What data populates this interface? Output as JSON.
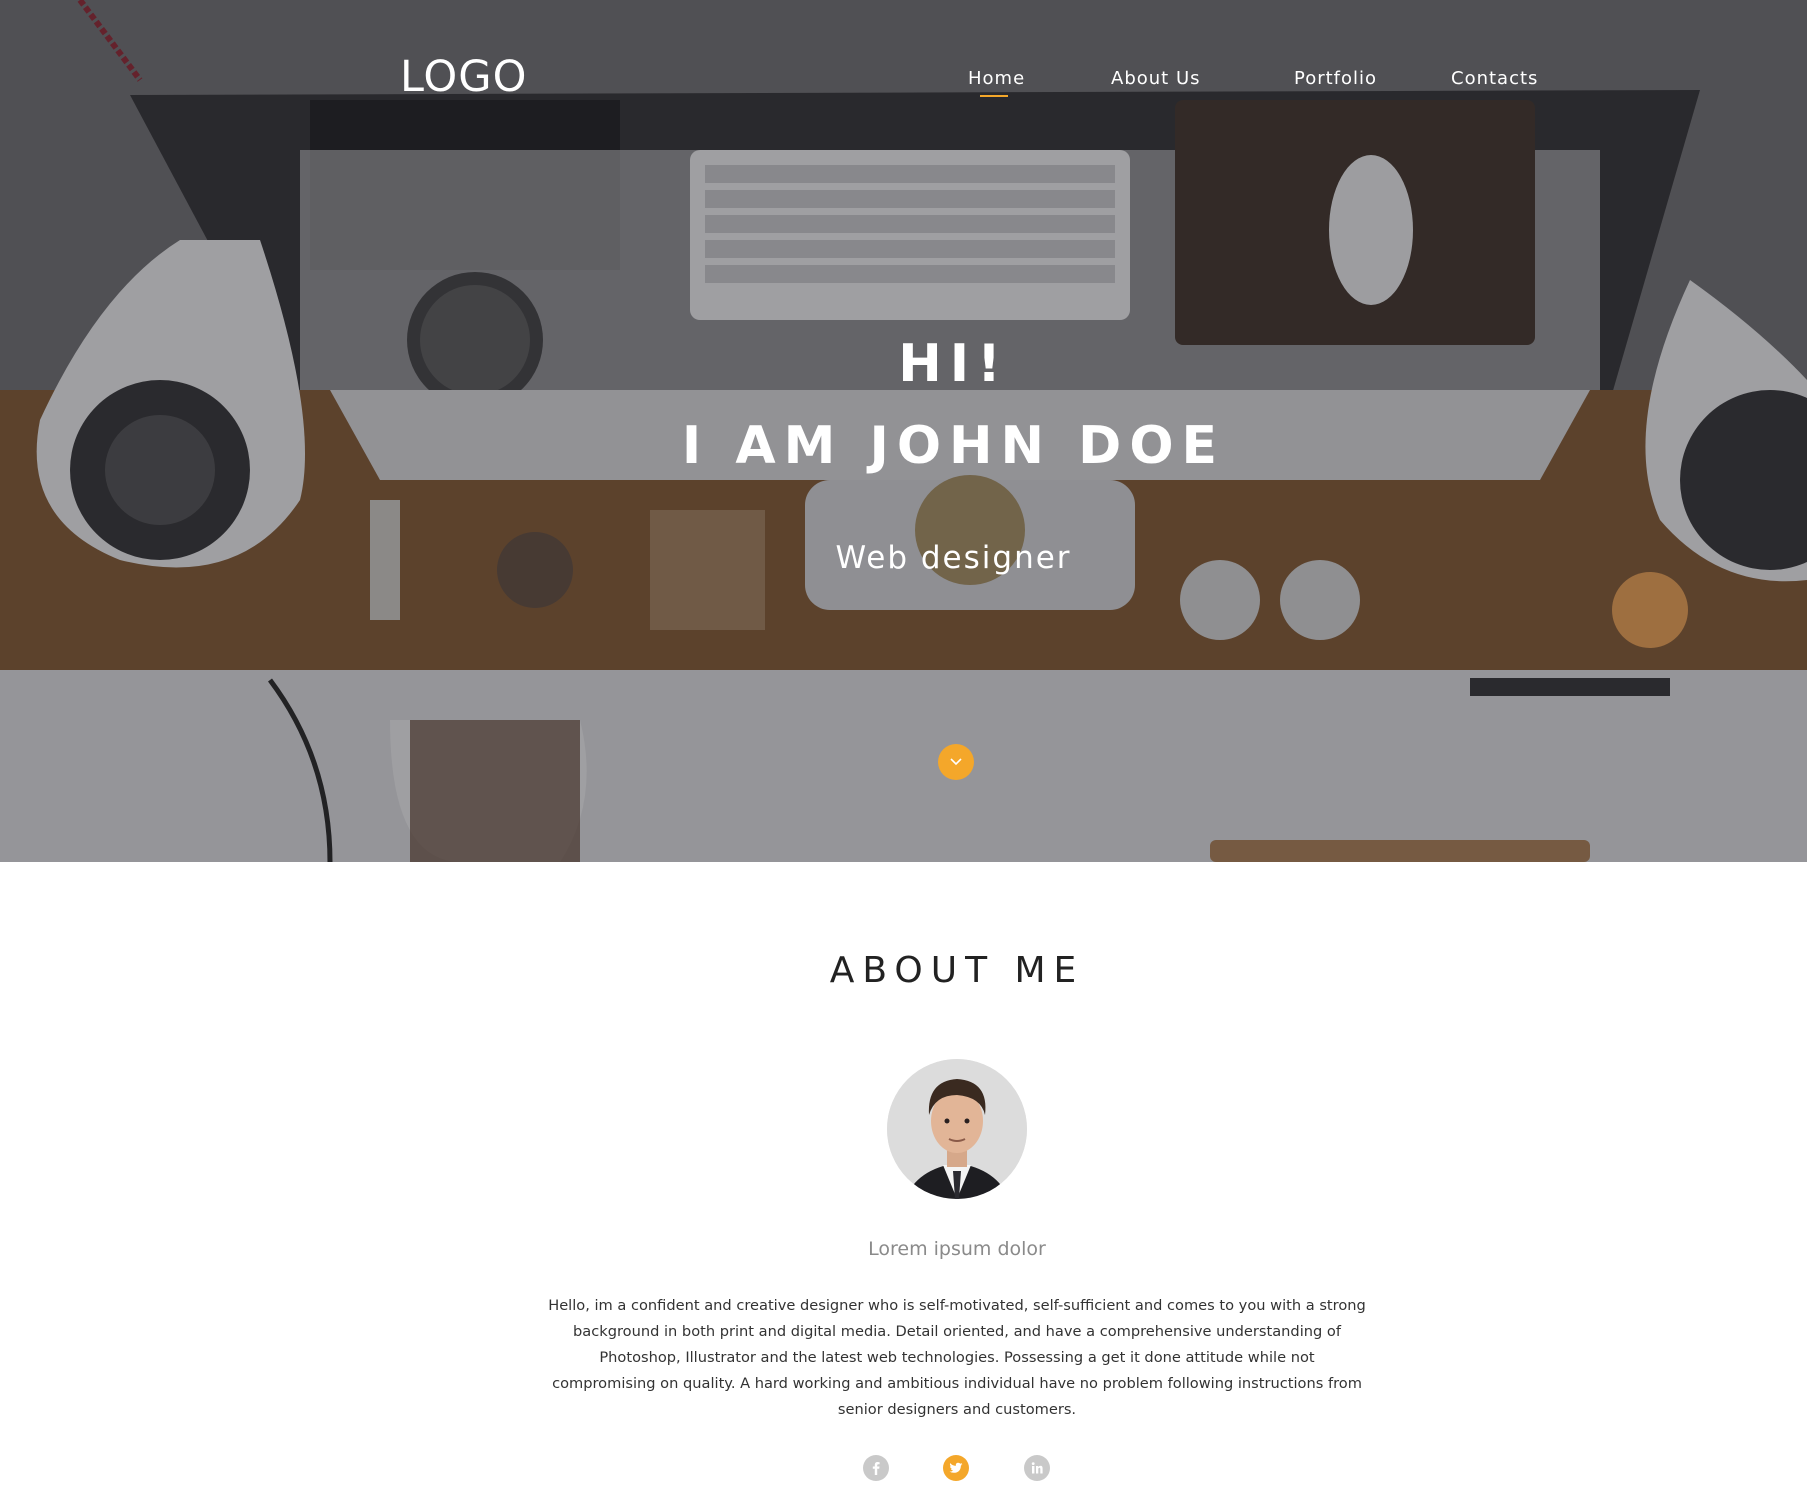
{
  "header": {
    "logo": "LOGO",
    "nav": [
      {
        "label": "Home",
        "active": true
      },
      {
        "label": "About Us",
        "active": false
      },
      {
        "label": "Portfolio",
        "active": false
      },
      {
        "label": "Contacts",
        "active": false
      }
    ]
  },
  "hero": {
    "greeting": "HI!",
    "name": "I AM JOHN DOE",
    "role": "Web designer",
    "scroll_icon": "chevron-down-icon"
  },
  "about": {
    "title": "ABOUT ME",
    "subtitle": "Lorem ipsum dolor",
    "text": "Hello, im a confident and creative designer who is self-motivated, self-sufficient and comes to you with a strong background in both print and digital media. Detail oriented, and have a comprehensive understanding of Photoshop, Illustrator and the latest web technologies. Possessing a get it done attitude while not compromising on quality. A hard working and ambitious individual have no problem following instructions from senior designers and customers.",
    "social": [
      {
        "icon": "facebook-icon",
        "color": "#c9c9c9"
      },
      {
        "icon": "twitter-icon",
        "color": "#f4a72a"
      },
      {
        "icon": "linkedin-icon",
        "color": "#c9c9c9"
      }
    ]
  },
  "colors": {
    "accent": "#f4a72a",
    "hero_overlay": "#3a3a3e",
    "text_dark": "#222222",
    "text_muted": "#8a8a8a"
  }
}
